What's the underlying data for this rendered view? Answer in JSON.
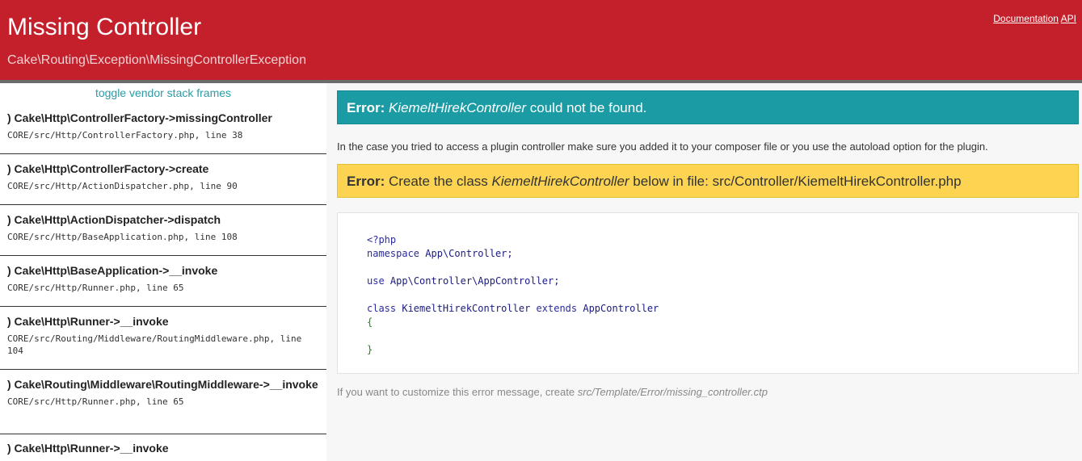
{
  "header": {
    "title": "Missing Controller",
    "subtitle": "Cake\\Routing\\Exception\\MissingControllerException",
    "links": {
      "documentation": "Documentation",
      "api": "API"
    }
  },
  "sidebar": {
    "toggle_label": "toggle vendor stack frames",
    "frames": [
      {
        "fn": ") Cake\\Http\\ControllerFactory->missingController",
        "file": "CORE/src/Http/ControllerFactory.php, line 38"
      },
      {
        "fn": ") Cake\\Http\\ControllerFactory->create",
        "file": "CORE/src/Http/ActionDispatcher.php, line 90"
      },
      {
        "fn": ") Cake\\Http\\ActionDispatcher->dispatch",
        "file": "CORE/src/Http/BaseApplication.php, line 108"
      },
      {
        "fn": ") Cake\\Http\\BaseApplication->__invoke",
        "file": "CORE/src/Http/Runner.php, line 65"
      },
      {
        "fn": ") Cake\\Http\\Runner->__invoke",
        "file": "CORE/src/Routing/Middleware/RoutingMiddleware.php, line 104"
      },
      {
        "fn": ") Cake\\Routing\\Middleware\\RoutingMiddleware->__invoke",
        "file": "CORE/src/Http/Runner.php, line 65"
      },
      {
        "fn": ") Cake\\Http\\Runner->__invoke",
        "file": ""
      }
    ]
  },
  "main": {
    "error_banner": {
      "label": "Error:",
      "class_name": "KiemeltHirekController",
      "message": " could not be found."
    },
    "info_text": "In the case you tried to access a plugin controller make sure you added it to your composer file or you use the autoload option for the plugin.",
    "create_banner": {
      "label": "Error:",
      "before": " Create the class ",
      "class_name": "KiemeltHirekController",
      "after": " below in file: src/Controller/KiemeltHirekController.php"
    },
    "code": {
      "open_tag": "<?php",
      "ns_kw": "namespace",
      "ns_value": "App\\Controller;",
      "use_kw": "use",
      "use_value": "App\\Controller\\AppController;",
      "class_kw": "class",
      "class_name": "KiemeltHirekController",
      "extends_kw": "extends",
      "parent": "AppController",
      "open_brace": "{",
      "close_brace": "}"
    },
    "footer": {
      "text": "If you want to customize this error message, create ",
      "path": "src/Template/Error/missing_controller.ctp"
    }
  },
  "colors": {
    "header_bg": "#c3202c",
    "error_banner_bg": "#1b9ba4",
    "create_banner_bg": "#fdd451",
    "link_teal": "#2a9ca6"
  }
}
